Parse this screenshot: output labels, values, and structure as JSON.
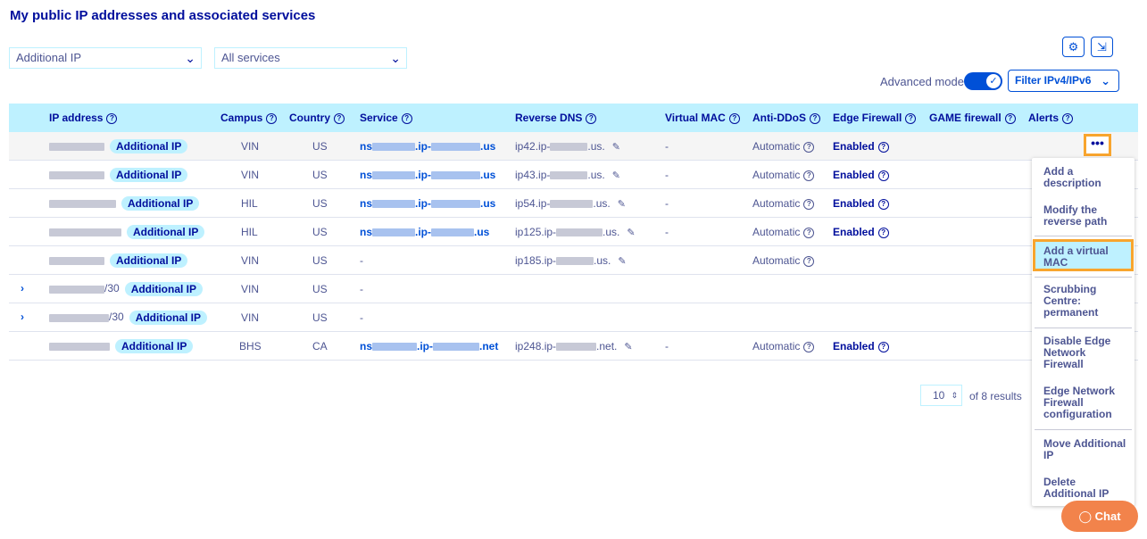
{
  "title": "My public IP addresses and associated services",
  "filters": {
    "type_select": "Additional IP",
    "service_select": "All services",
    "advanced_mode_label": "Advanced mode",
    "ip_filter_label": "Filter IPv4/IPv6"
  },
  "toolbar": {
    "settings_icon": "gear-icon",
    "export_icon": "export-icon"
  },
  "columns": [
    "IP address",
    "Campus",
    "Country",
    "Service",
    "Reverse DNS",
    "Virtual MAC",
    "Anti-DDoS",
    "Edge Firewall",
    "GAME firewall",
    "Alerts"
  ],
  "rows": [
    {
      "ip_suffix": "",
      "badge": "Additional IP",
      "campus": "VIN",
      "country": "US",
      "service_a": "ns",
      "service_b": ".ip-",
      "service_c": ".us",
      "reverse_a": "ip42.ip-",
      "reverse_b": ".us.",
      "vmac": "-",
      "ddos": "Automatic",
      "edge": "Enabled"
    },
    {
      "ip_suffix": "",
      "badge": "Additional IP",
      "campus": "VIN",
      "country": "US",
      "service_a": "ns",
      "service_b": ".ip-",
      "service_c": ".us",
      "reverse_a": "ip43.ip-",
      "reverse_b": ".us.",
      "vmac": "-",
      "ddos": "Automatic",
      "edge": "Enabled"
    },
    {
      "ip_suffix": "",
      "badge": "Additional IP",
      "campus": "HIL",
      "country": "US",
      "service_a": "ns",
      "service_b": ".ip-",
      "service_c": ".us",
      "reverse_a": "ip54.ip-",
      "reverse_b": ".us.",
      "vmac": "-",
      "ddos": "Automatic",
      "edge": "Enabled"
    },
    {
      "ip_suffix": "",
      "badge": "Additional IP",
      "campus": "HIL",
      "country": "US",
      "service_a": "ns",
      "service_b": ".ip-",
      "service_c": ".us",
      "reverse_a": "ip125.ip-",
      "reverse_b": ".us.",
      "vmac": "-",
      "ddos": "Automatic",
      "edge": "Enabled"
    },
    {
      "ip_suffix": "",
      "badge": "Additional IP",
      "campus": "VIN",
      "country": "US",
      "service_dash": "-",
      "reverse_a": "ip185.ip-",
      "reverse_b": ".us.",
      "ddos": "Automatic"
    },
    {
      "ip_suffix": "/30",
      "badge": "Additional IP",
      "campus": "VIN",
      "country": "US",
      "service_dash": "-"
    },
    {
      "ip_suffix": "/30",
      "badge": "Additional IP",
      "campus": "VIN",
      "country": "US",
      "service_dash": "-"
    },
    {
      "ip_suffix": "",
      "badge": "Additional IP",
      "campus": "BHS",
      "country": "CA",
      "service_a": "ns",
      "service_b": ".ip-",
      "service_c": ".net",
      "reverse_a": "ip248.ip-",
      "reverse_b": ".net.",
      "vmac": "-",
      "ddos": "Automatic",
      "edge": "Enabled"
    }
  ],
  "menu": {
    "items": [
      "Add a description",
      "Modify the reverse path",
      "Add a virtual MAC",
      "Scrubbing Centre: permanent",
      "Disable Edge Network Firewall",
      "Edge Network Firewall configuration",
      "Move Additional IP",
      "Delete Additional IP"
    ],
    "highlighted_index": 2
  },
  "pagination": {
    "page_size": "10",
    "total": "of 8 results"
  },
  "chat": {
    "label": "Chat"
  },
  "colors": {
    "accent": "#0050d7",
    "header_bg": "#bef1ff",
    "highlight": "#f8a52e",
    "title": "#000e9c",
    "chat": "#f2834b"
  }
}
